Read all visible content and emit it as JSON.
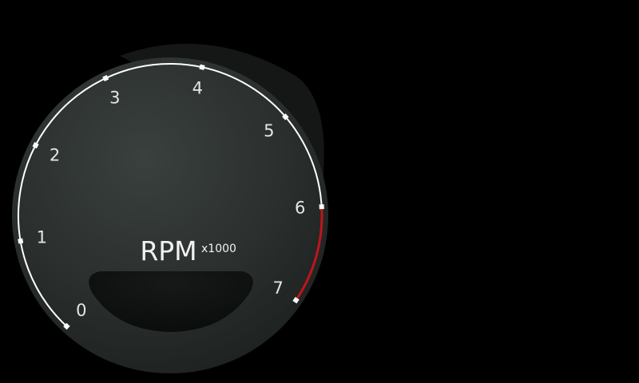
{
  "gauge": {
    "title": "RPM",
    "unit_multiplier": "x1000",
    "tick_labels": [
      "0",
      "1",
      "2",
      "3",
      "4",
      "5",
      "6",
      "7"
    ],
    "redline_start": 6,
    "max_value": 7,
    "colors": {
      "background": "#000000",
      "face": "#2b302f",
      "bezel": "#1b1f1e",
      "arc": "#ffffff",
      "redline": "#c0141c",
      "display_window": "#0e1010",
      "label": "#e6e6e6"
    }
  }
}
